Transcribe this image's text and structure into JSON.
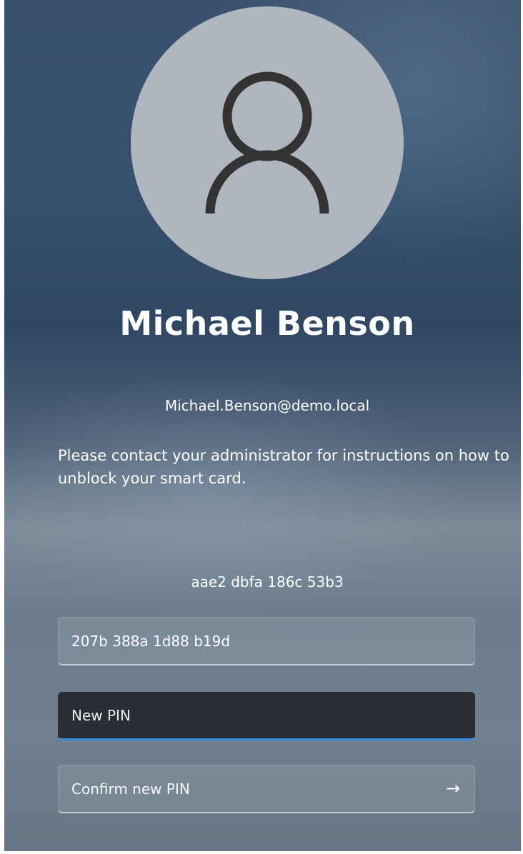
{
  "user": {
    "name": "Michael Benson",
    "email": "Michael.Benson@demo.local",
    "avatar_icon": "person-icon"
  },
  "message": "Please contact your administrator for instructions on how to unblock your smart card.",
  "challenge_code": "aae2 dbfa 186c 53b3",
  "fields": {
    "response": {
      "value": "207b 388a 1d88 b19d",
      "placeholder": ""
    },
    "new_pin": {
      "value": "",
      "placeholder": "New PIN"
    },
    "confirm_pin": {
      "value": "",
      "placeholder": "Confirm new PIN"
    }
  },
  "submit": {
    "icon": "arrow-right-icon",
    "glyph": "→"
  },
  "colors": {
    "focus_accent": "#3b8fe0",
    "focused_field_bg": "#2b2f35",
    "avatar_bg": "#b0b6bd",
    "avatar_glyph": "#333333"
  }
}
